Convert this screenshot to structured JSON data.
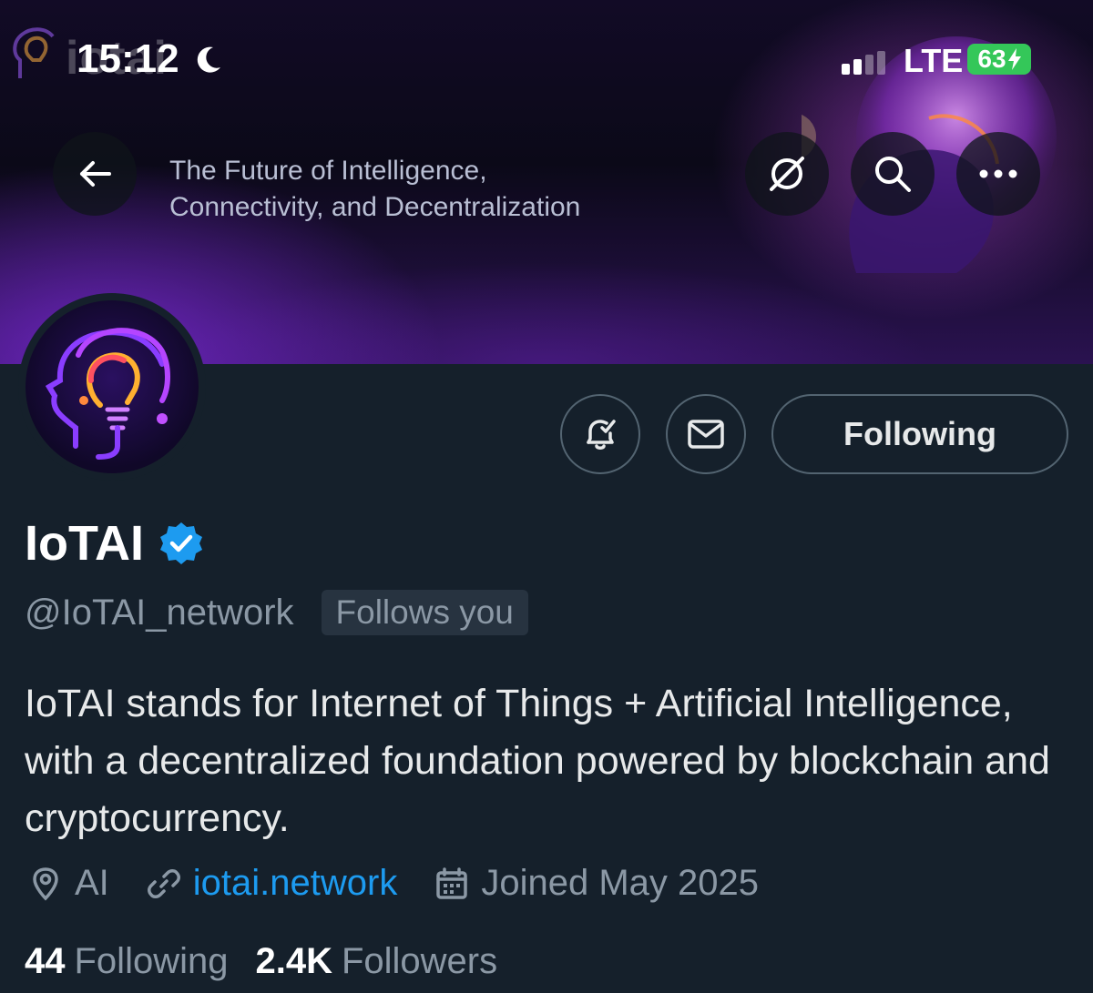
{
  "status_bar": {
    "time": "15:12",
    "network": "LTE",
    "battery": "63"
  },
  "banner": {
    "logo_text": "iotai",
    "tagline_line1": "The Future of Intelligence,",
    "tagline_line2": "Connectivity, and Decentralization"
  },
  "profile": {
    "display_name": "IoTAI",
    "handle": "@IoTAI_network",
    "follows_you": "Follows you",
    "bio": "IoTAI stands for Internet of Things + Artificial Intelligence, with a decentralized foundation powered by blockchain and cryptocurrency.",
    "location": "AI",
    "website": "iotai.network",
    "joined": "Joined May 2025",
    "following_count": "44",
    "following_label": "Following",
    "followers_count": "2.4K",
    "followers_label": "Followers"
  },
  "actions": {
    "following_button": "Following"
  },
  "icons": {
    "back": "arrow-left-icon",
    "grok": "grok-icon",
    "search": "search-icon",
    "more": "more-icon",
    "notify": "bell-check-icon",
    "message": "envelope-icon",
    "verified": "verified-badge-icon",
    "location": "location-pin-icon",
    "link": "link-icon",
    "calendar": "calendar-icon"
  },
  "colors": {
    "background": "#15202b",
    "accent": "#1d9bf0",
    "muted": "#8b98a5",
    "battery": "#34c759"
  }
}
